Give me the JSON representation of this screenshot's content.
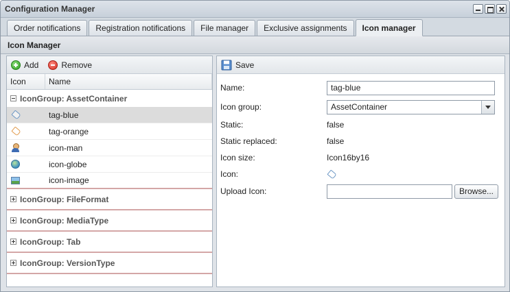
{
  "window": {
    "title": "Configuration Manager"
  },
  "tabs": [
    {
      "label": "Order notifications"
    },
    {
      "label": "Registration notifications"
    },
    {
      "label": "File manager"
    },
    {
      "label": "Exclusive assignments"
    },
    {
      "label": "Icon manager",
      "active": true
    }
  ],
  "panel": {
    "title": "Icon Manager"
  },
  "left_toolbar": {
    "add_label": "Add",
    "remove_label": "Remove"
  },
  "grid": {
    "columns": {
      "icon": "Icon",
      "name": "Name"
    },
    "expanded_group": {
      "label": "IconGroup: AssetContainer",
      "items": [
        {
          "name": "tag-blue",
          "icon": "tag-blue-icon",
          "selected": true
        },
        {
          "name": "tag-orange",
          "icon": "tag-orange-icon"
        },
        {
          "name": "icon-man",
          "icon": "man-icon"
        },
        {
          "name": "icon-globe",
          "icon": "globe-icon"
        },
        {
          "name": "icon-image",
          "icon": "image-icon"
        }
      ]
    },
    "collapsed_groups": [
      {
        "label": "IconGroup: FileFormat"
      },
      {
        "label": "IconGroup: MediaType"
      },
      {
        "label": "IconGroup: Tab"
      },
      {
        "label": "IconGroup: VersionType"
      }
    ]
  },
  "right_toolbar": {
    "save_label": "Save"
  },
  "form": {
    "name": {
      "label": "Name:",
      "value": "tag-blue"
    },
    "icon_group": {
      "label": "Icon group:",
      "value": "AssetContainer"
    },
    "static": {
      "label": "Static:",
      "value": "false"
    },
    "static_replaced": {
      "label": "Static replaced:",
      "value": "false"
    },
    "icon_size": {
      "label": "Icon size:",
      "value": "Icon16by16"
    },
    "icon": {
      "label": "Icon:",
      "icon": "tag-blue-icon"
    },
    "upload_icon": {
      "label": "Upload Icon:",
      "value": "",
      "browse_label": "Browse..."
    }
  }
}
